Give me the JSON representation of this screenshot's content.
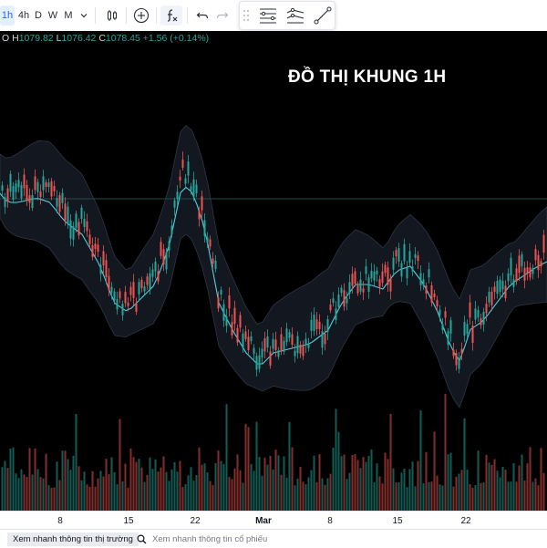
{
  "toolbar": {
    "interval_active": "1h",
    "intervals": [
      "4h",
      "D",
      "W",
      "M"
    ],
    "icons": [
      "chevron-down-icon",
      "candles-icon",
      "add-indicator-icon",
      "indicators-icon",
      "undo-icon",
      "redo-icon",
      "drag-handle-icon",
      "horizontal-lines-icon",
      "trend-lines-icon",
      "brush-icon"
    ]
  },
  "ohlc": {
    "open_suffix": "O",
    "h_label": "H",
    "h_value": "1079.82",
    "l_label": "L",
    "l_value": "1076.42",
    "c_label": "C",
    "c_value": "1078.45",
    "change": "+1.56 (+0.14%)"
  },
  "overlay_title": "ĐỒ THỊ KHUNG 1H",
  "x_axis": {
    "labels": [
      "8",
      "15",
      "22",
      "Mar",
      "8",
      "15",
      "22"
    ]
  },
  "bottom_bar": {
    "market_button": "Xem nhanh thông tin thị trường",
    "search_placeholder": "Xem nhanh thông tin cổ phiếu"
  },
  "colors": {
    "up": "#26a69a",
    "down": "#ef5350",
    "band_line": "#4dd0e1",
    "background": "#000000"
  }
}
